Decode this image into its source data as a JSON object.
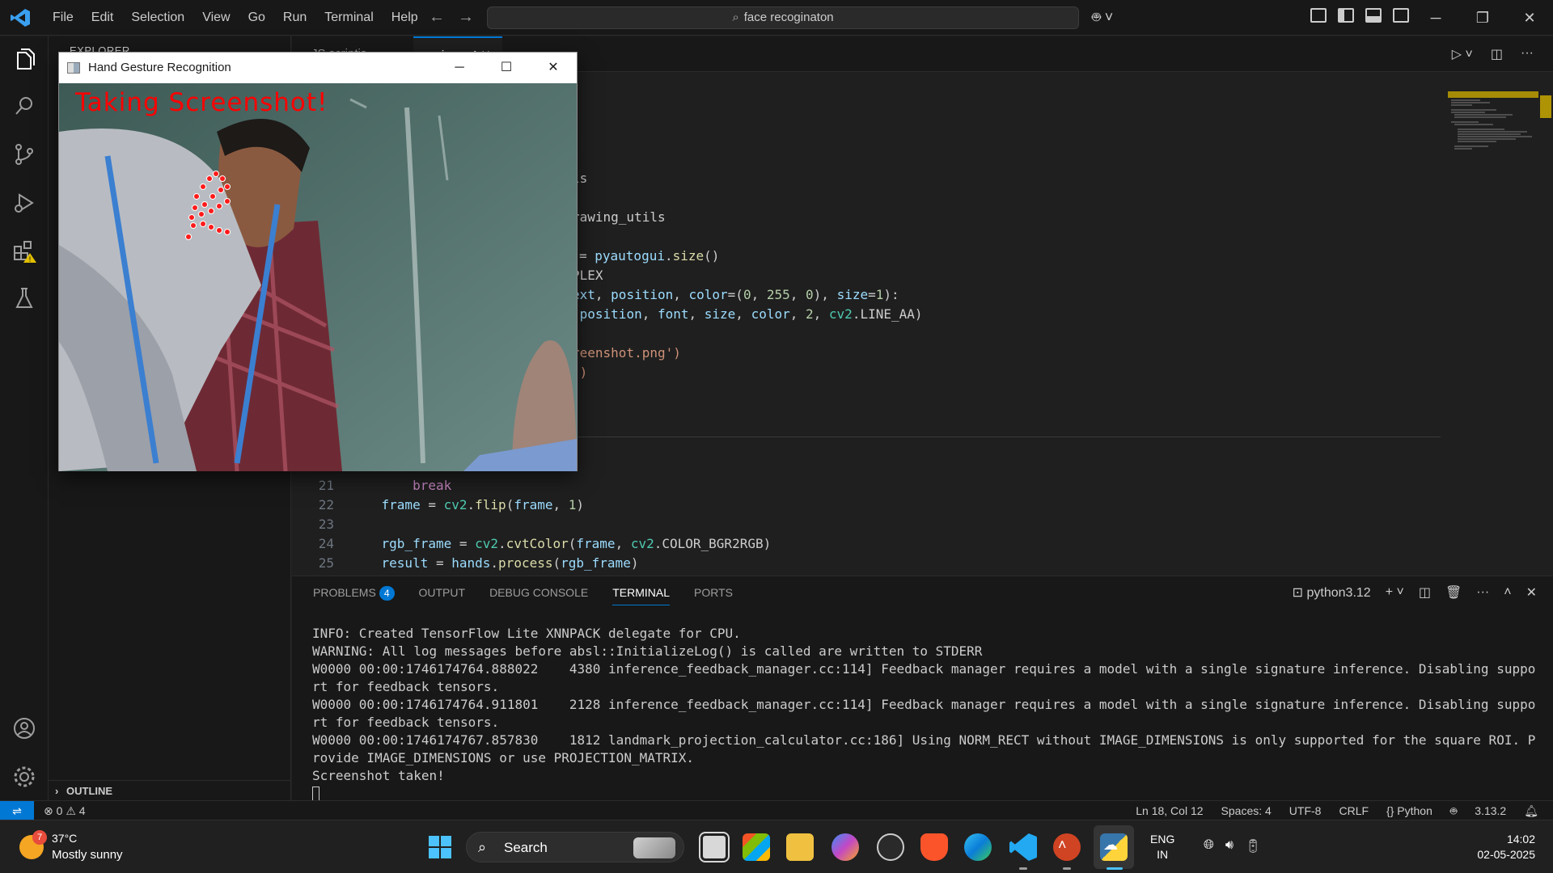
{
  "titlebar": {
    "menu": [
      "File",
      "Edit",
      "Selection",
      "View",
      "Go",
      "Run",
      "Terminal",
      "Help"
    ],
    "search": "face recoginaton"
  },
  "sidebar": {
    "header": "EXPLORER",
    "outline": "OUTLINE"
  },
  "tabs": [
    {
      "label": "JS  scriptjs"
    },
    {
      "label": "main.py  4"
    }
  ],
  "editor": {
    "fragments": [
      {
        "text": "ls",
        "cls": "plain"
      },
      {
        "text": "rawing_utils",
        "cls": "plain"
      },
      {
        "text": "= pyautogui.size()",
        "cls": "plain"
      },
      {
        "text": "PLEX",
        "cls": "plain"
      },
      {
        "text": "ext, position, color=(0, 255, 0), size=1):",
        "cls": "plain"
      },
      {
        "text": " position, font, size, color, 2, cv2.LINE_AA)",
        "cls": "plain"
      },
      {
        "text": "reenshot.png')",
        "cls": "str"
      },
      {
        "text": "\")",
        "cls": "str"
      }
    ],
    "lines": [
      {
        "num": "21",
        "text": "        break"
      },
      {
        "num": "22",
        "text": "    frame = cv2.flip(frame, 1)"
      },
      {
        "num": "23",
        "text": ""
      },
      {
        "num": "24",
        "text": "    rgb_frame = cv2.cvtColor(frame, cv2.COLOR_BGR2RGB)"
      },
      {
        "num": "25",
        "text": "    result = hands.process(rgb_frame)"
      }
    ]
  },
  "panel": {
    "tabs": [
      "PROBLEMS",
      "OUTPUT",
      "DEBUG CONSOLE",
      "TERMINAL",
      "PORTS"
    ],
    "problems_count": "4",
    "active_tab": "TERMINAL",
    "shell": "python3.12",
    "terminal_lines": [
      "INFO: Created TensorFlow Lite XNNPACK delegate for CPU.",
      "WARNING: All log messages before absl::InitializeLog() is called are written to STDERR",
      "W0000 00:00:1746174764.888022    4380 inference_feedback_manager.cc:114] Feedback manager requires a model with a single signature inference. Disabling support for feedback tensors.",
      "W0000 00:00:1746174764.911801    2128 inference_feedback_manager.cc:114] Feedback manager requires a model with a single signature inference. Disabling support for feedback tensors.",
      "W0000 00:00:1746174767.857830    1812 landmark_projection_calculator.cc:186] Using NORM_RECT without IMAGE_DIMENSIONS is only supported for the square ROI. Provide IMAGE_DIMENSIONS or use PROJECTION_MATRIX.",
      "Screenshot taken!"
    ]
  },
  "statusbar": {
    "errors": "0",
    "warnings": "4",
    "position": "Ln 18, Col 12",
    "spaces": "Spaces: 4",
    "encoding": "UTF-8",
    "eol": "CRLF",
    "language": "Python",
    "version": "3.13.2"
  },
  "gesture_window": {
    "title": "Hand Gesture Recognition",
    "overlay_text": "Taking Screenshot!"
  },
  "taskbar": {
    "weather_temp": "37°C",
    "weather_cond": "Mostly sunny",
    "weather_alert": "7",
    "search": "Search",
    "lang_line1": "ENG",
    "lang_line2": "IN",
    "time": "14:02",
    "date": "02-05-2025"
  }
}
